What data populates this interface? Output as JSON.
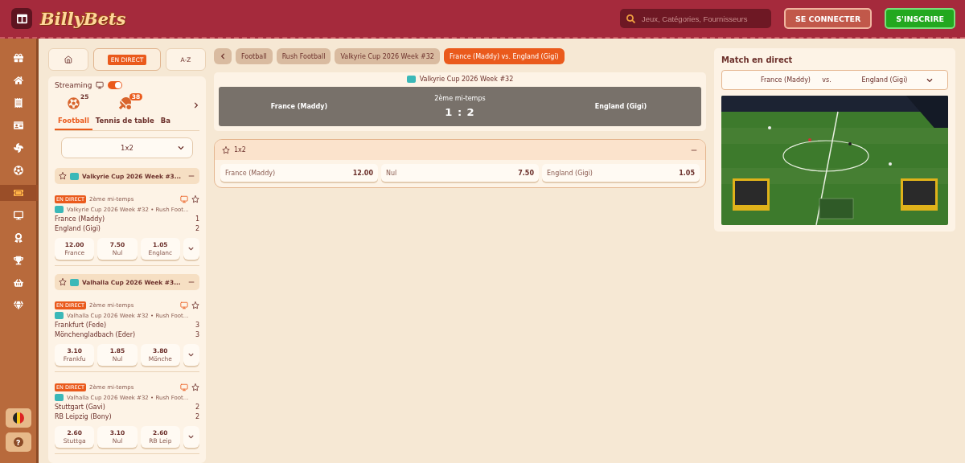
{
  "header": {
    "logo": "BillyBets",
    "search": {
      "placeholder": "Jeux, Catégories, Fournisseurs"
    },
    "buttons": [
      {
        "label": "SE CONNECTER",
        "kind": "login"
      },
      {
        "label": "S'INSCRIRE",
        "kind": "signup"
      }
    ]
  },
  "rail": {
    "items": [
      {
        "kind": "gift",
        "selected": false
      },
      {
        "kind": "home",
        "selected": false
      },
      {
        "kind": "receipt",
        "selected": false
      },
      {
        "kind": "card",
        "selected": false
      },
      {
        "kind": "fan",
        "selected": false
      },
      {
        "kind": "ball",
        "selected": false
      },
      {
        "kind": "ticket",
        "selected": true
      },
      {
        "kind": "monitor",
        "selected": false
      },
      {
        "kind": "award",
        "selected": false
      },
      {
        "kind": "trophy",
        "selected": false
      },
      {
        "kind": "basket",
        "selected": false
      },
      {
        "kind": "gem",
        "selected": false
      }
    ]
  },
  "sidebar": {
    "nav": [
      {
        "kind": "home",
        "selected": false
      },
      {
        "kind": "live",
        "label": "EN DIRECT",
        "selected": true
      },
      {
        "kind": "text",
        "label": "A-Z",
        "selected": false
      }
    ],
    "streaming": {
      "label": "Streaming",
      "on": true
    },
    "sports": [
      {
        "label": "Football",
        "count": "25",
        "kind": "football",
        "selected": true
      },
      {
        "label": "Tennis de table",
        "count": "38",
        "kind": "tennis",
        "selected": false
      },
      {
        "label": "Ba",
        "kind": "none",
        "selected": false
      }
    ],
    "market": {
      "value": "1x2"
    },
    "groups": [
      {
        "title": "Valkyrie Cup 2026 Week #3...",
        "expanded": true,
        "events": [
          {
            "badge": "EN DIRECT",
            "period": "2ème mi-temps",
            "league": "Valkyrie Cup 2026 Week #32 • Rush Foot...",
            "teams": [
              {
                "name": "France (Maddy)",
                "score": "1"
              },
              {
                "name": "England (Gigi)",
                "score": "2"
              }
            ],
            "odds": [
              {
                "value": "12.00",
                "label": "France"
              },
              {
                "value": "7.50",
                "label": "Nul"
              },
              {
                "value": "1.05",
                "label": "Englanc"
              }
            ]
          }
        ]
      },
      {
        "title": "Valhalla Cup 2026 Week #3...",
        "expanded": true,
        "events": [
          {
            "badge": "EN DIRECT",
            "period": "2ème mi-temps",
            "league": "Valhalla Cup 2026 Week #32 • Rush Foot...",
            "teams": [
              {
                "name": "Frankfurt (Fede)",
                "score": "3"
              },
              {
                "name": "Mönchengladbach (Eder)",
                "score": "3"
              }
            ],
            "odds": [
              {
                "value": "3.10",
                "label": "Frankfu"
              },
              {
                "value": "1.85",
                "label": "Nul"
              },
              {
                "value": "3.80",
                "label": "Mönche"
              }
            ]
          },
          {
            "badge": "EN DIRECT",
            "period": "2ème mi-temps",
            "league": "Valhalla Cup 2026 Week #32 • Rush Foot...",
            "teams": [
              {
                "name": "Stuttgart (Gavi)",
                "score": "2"
              },
              {
                "name": "RB Leipzig (Bony)",
                "score": "2"
              }
            ],
            "odds": [
              {
                "value": "2.60",
                "label": "Stuttga"
              },
              {
                "value": "3.10",
                "label": "Nul"
              },
              {
                "value": "2.60",
                "label": "RB Leip"
              }
            ]
          }
        ]
      }
    ]
  },
  "breadcrumbs": [
    {
      "label": "Football",
      "selected": false
    },
    {
      "label": "Rush Football",
      "selected": false
    },
    {
      "label": "Valkyrie Cup 2026 Week #32",
      "selected": false
    },
    {
      "label": "France (Maddy) vs. England (Gigi)",
      "selected": true
    }
  ],
  "match": {
    "league": "Valkyrie Cup 2026 Week #32",
    "home": "France (Maddy)",
    "away": "England (Gigi)",
    "period": "2ème mi-temps",
    "score": "1 : 2"
  },
  "markets": [
    {
      "title": "1x2",
      "expanded": true,
      "outcomes": [
        {
          "label": "France (Maddy)",
          "odd": "12.00"
        },
        {
          "label": "Nul",
          "odd": "7.50"
        },
        {
          "label": "England (Gigi)",
          "odd": "1.05"
        }
      ]
    }
  ],
  "live": {
    "title": "Match en direct",
    "home": "France (Maddy)",
    "vs": "vs.",
    "away": "England (Gigi)"
  }
}
